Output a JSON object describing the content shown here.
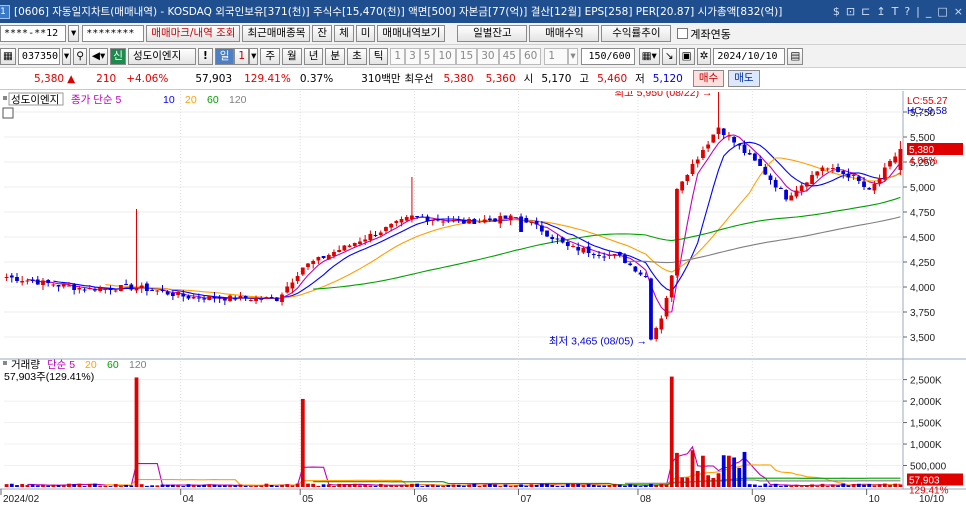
{
  "window": {
    "screen_no": "1",
    "title": "[0606] 자동일지차트(매매내역) - KOSDAQ 외국인보유[371(천)] 주식수[15,470(천)] 액면[500] 자본금[77(억)] 결산[12월] EPS[258] PER[20.87] 시가총액[832(억)] ",
    "controls": [
      "$",
      "⊡",
      "⊏",
      "↥",
      "T",
      "?",
      "|",
      "_",
      "□",
      "×"
    ]
  },
  "toolbar1": {
    "account": "****-**12",
    "password": "********",
    "buttons": [
      "매매마크/내역 조회",
      "최근매매종목",
      "잔",
      "체",
      "미",
      "매매내역보기"
    ],
    "right_buttons": [
      "일별잔고",
      "매매수익",
      "수익률추이"
    ],
    "checkbox_label": "계좌연동"
  },
  "toolbar2": {
    "code": "037350",
    "badge": "신",
    "stock_name": "성도이엔지",
    "warn": "!",
    "period_sel": "일",
    "period_num": "1",
    "periods": [
      "주",
      "월",
      "년",
      "분",
      "초",
      "틱"
    ],
    "intervals": [
      "1",
      "3",
      "5",
      "10",
      "15",
      "30",
      "45",
      "60"
    ],
    "custom": "1",
    "count": "150/600",
    "date": "2024/10/10"
  },
  "quote": {
    "price": "5,380",
    "arrow": "▲",
    "change": "210",
    "change_pct": "+4.06%",
    "volume": "57,903",
    "volume_ratio": "129.41%",
    "turnover": "0.37%",
    "amount": "310백만",
    "best_label": "최우선",
    "best_ask": "5,380",
    "best_bid": "5,360",
    "open_label": "시",
    "open": "5,170",
    "high_label": "고",
    "high": "5,460",
    "low_label": "저",
    "low": "5,120",
    "buy": "매수",
    "sell": "매도"
  },
  "chart_data": [
    {
      "type": "candlestick",
      "name": "성도이엔지",
      "legend": [
        "성도이엔지",
        "종가 단순 5",
        "10",
        "20",
        "60",
        "120"
      ],
      "legend_colors": [
        "#000000",
        "#c000c0",
        "#0000ff",
        "#ffa000",
        "#00a000",
        "#808080"
      ],
      "y_ticks": [
        5750,
        5500,
        5250,
        5000,
        4750,
        4500,
        4250,
        4000,
        3750,
        3500
      ],
      "ylim": [
        3330,
        5900
      ],
      "badge_top": "LC:55.27",
      "badge_hc": "HC:-9.58",
      "last_price": "5,380",
      "last_pct": "4.06%",
      "ann_high": "최고 5,950 (08/22) →",
      "ann_low": "최저 3,465 (08/05) →",
      "key_points": [
        {
          "date": "2024/03/19",
          "high": 4780
        },
        {
          "date": "2024/05/31",
          "high": 5100
        },
        {
          "date": "2024/07/01",
          "close": 4550
        },
        {
          "date": "2024/08/05",
          "low": 3465
        },
        {
          "date": "2024/08/22",
          "high": 5950
        },
        {
          "date": "2024/10/10",
          "open": 5170,
          "high": 5460,
          "low": 5120,
          "close": 5380
        }
      ]
    },
    {
      "type": "bar",
      "name": "거래량",
      "legend": [
        "거래량",
        "단순 5",
        "20",
        "60",
        "120"
      ],
      "legend_colors": [
        "#000000",
        "#c000c0",
        "#ffa000",
        "#00a000",
        "#808080"
      ],
      "y_ticks": [
        "2,500K",
        "2,000K",
        "1,500K",
        "1,000K",
        "500,000"
      ],
      "ylim": [
        0,
        2700000
      ],
      "info": "57,903주(129.41%)",
      "last_volume": "57,903",
      "last_pct": "129.41%",
      "peaks": [
        {
          "date": "2024/03/19",
          "volume": 2550000
        },
        {
          "date": "2024/05/02",
          "volume": 2050000
        },
        {
          "date": "2024/08/09",
          "volume": 2570000
        }
      ]
    }
  ],
  "x_labels": [
    "2024/02",
    "04",
    "05",
    "06",
    "07",
    "08",
    "09",
    "10"
  ],
  "x_end": "10/10"
}
